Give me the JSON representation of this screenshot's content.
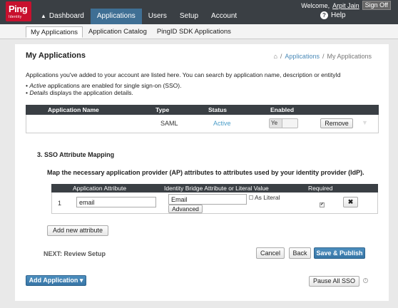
{
  "brand": {
    "logo_text": "Ping",
    "logo_sub": "Identity"
  },
  "header": {
    "welcome": "Welcome,",
    "user": "Arpit Jain",
    "signoff": "Sign Off",
    "help": "Help",
    "nav": [
      {
        "label": "Dashboard"
      },
      {
        "label": "Applications"
      },
      {
        "label": "Users"
      },
      {
        "label": "Setup"
      },
      {
        "label": "Account"
      }
    ]
  },
  "subnav": {
    "tabs": [
      {
        "label": "My Applications"
      },
      {
        "label": "Application Catalog"
      },
      {
        "label": "PingID SDK Applications"
      }
    ]
  },
  "page": {
    "title": "My Applications",
    "breadcrumb": {
      "link": "Applications",
      "sep": "/",
      "current": "My Applications"
    },
    "description": "Applications you've added to your account are listed here. You can search by application name, description or entityId",
    "bullets": [
      {
        "bold_word": "Active",
        "rest": " applications are enabled for single sign-on (SSO)."
      },
      {
        "bold_word": "Details",
        "rest": " displays the application details."
      }
    ]
  },
  "apps_table": {
    "headers": [
      "Application Name",
      "Type",
      "Status",
      "Enabled"
    ],
    "row": {
      "type": "SAML",
      "status": "Active",
      "enabled_label": "Ye",
      "remove_label": "Remove"
    }
  },
  "sso_mapping": {
    "section_title": "3. SSO Attribute Mapping",
    "description": "Map the necessary application provider (AP) attributes to attributes used by your identity provider (IdP).",
    "headers": [
      "Application Attribute",
      "Identity Bridge Attribute or Literal Value",
      "Required"
    ],
    "row": {
      "index": "1",
      "application_attribute": "email",
      "literal_value": "Email",
      "advanced_label": "Advanced",
      "as_literal_label": "As Literal",
      "required_mark": "✔",
      "delete_label": "✖"
    },
    "add_attribute_label": "Add new attribute"
  },
  "footer": {
    "next": "NEXT: Review Setup",
    "cancel": "Cancel",
    "back": "Back",
    "publish": "Save & Publish",
    "add_application": "Add Application ▾",
    "pause_all": "Pause All SSO"
  },
  "colors": {
    "nav_bg": "#3a3f44",
    "nav_active": "#3f6f94",
    "accent": "#3775a6",
    "brand_red": "#c8102e"
  }
}
